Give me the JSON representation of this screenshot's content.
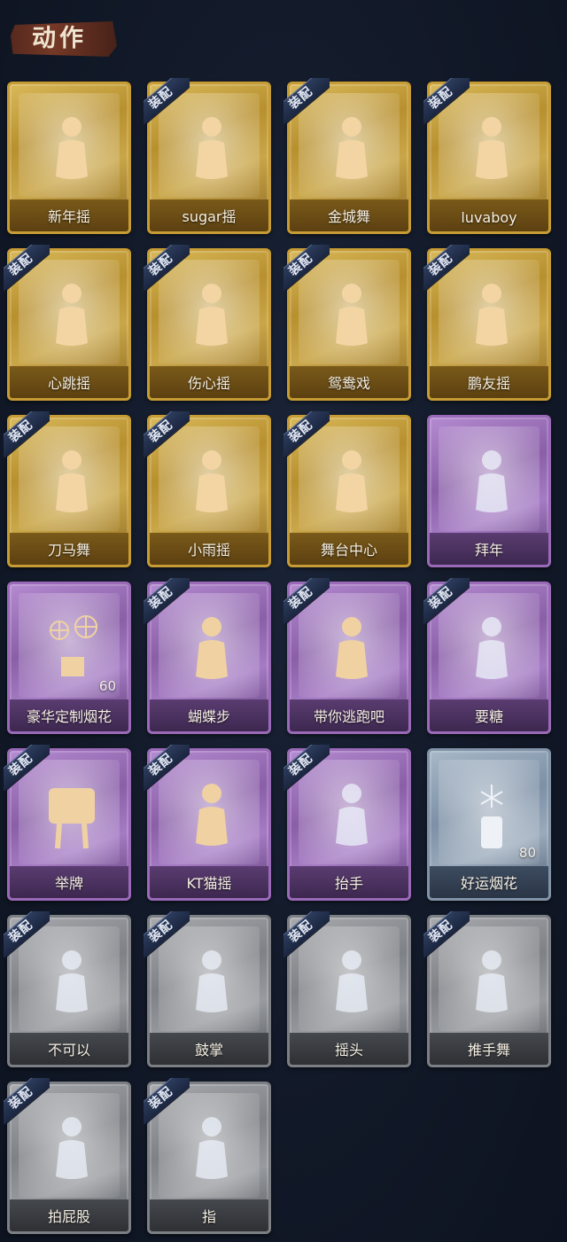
{
  "header": {
    "title": "动作"
  },
  "badge_text": "装配",
  "cards": [
    {
      "label": "新年摇",
      "rarity": "gold",
      "equipped": false,
      "icon": "dancer-clap-icon"
    },
    {
      "label": "sugar摇",
      "rarity": "gold",
      "equipped": true,
      "icon": "dancer-music-icon"
    },
    {
      "label": "金城舞",
      "rarity": "gold",
      "equipped": true,
      "icon": "dancer-wave-icon"
    },
    {
      "label": "luvaboy",
      "rarity": "gold",
      "equipped": true,
      "icon": "dancer-cross-arms-icon"
    },
    {
      "label": "心跳摇",
      "rarity": "gold",
      "equipped": true,
      "icon": "dancer-raise-arm-icon"
    },
    {
      "label": "伤心摇",
      "rarity": "gold",
      "equipped": true,
      "icon": "dancer-heart-hands-icon"
    },
    {
      "label": "鸳鸯戏",
      "rarity": "gold",
      "equipped": true,
      "icon": "dancer-music-icon"
    },
    {
      "label": "鹏友摇",
      "rarity": "gold",
      "equipped": true,
      "icon": "dancer-point-icon"
    },
    {
      "label": "刀马舞",
      "rarity": "gold",
      "equipped": true,
      "icon": "dancer-fist-icon"
    },
    {
      "label": "小雨摇",
      "rarity": "gold",
      "equipped": true,
      "icon": "dancer-music-icon"
    },
    {
      "label": "舞台中心",
      "rarity": "gold",
      "equipped": true,
      "icon": "dancer-sparkle-icon"
    },
    {
      "label": "拜年",
      "rarity": "purple",
      "equipped": false,
      "icon": "bow-greeting-icon"
    },
    {
      "label": "豪华定制烟花",
      "rarity": "purple",
      "equipped": false,
      "icon": "fireworks-box-icon",
      "count": "60"
    },
    {
      "label": "蝴蝶步",
      "rarity": "purple",
      "equipped": true,
      "icon": "dancer-point-icon"
    },
    {
      "label": "带你逃跑吧",
      "rarity": "purple",
      "equipped": true,
      "icon": "dancer-music-icon"
    },
    {
      "label": "要糖",
      "rarity": "purple",
      "equipped": true,
      "icon": "reach-out-icon"
    },
    {
      "label": "举牌",
      "rarity": "purple",
      "equipped": true,
      "icon": "sign-hold-icon"
    },
    {
      "label": "KT猫摇",
      "rarity": "purple",
      "equipped": true,
      "icon": "dancer-music-icon"
    },
    {
      "label": "抬手",
      "rarity": "purple",
      "equipped": true,
      "icon": "raise-hand-icon"
    },
    {
      "label": "好运烟花",
      "rarity": "blue",
      "equipped": false,
      "icon": "firework-can-icon",
      "count": "80"
    },
    {
      "label": "不可以",
      "rarity": "gray",
      "equipped": true,
      "icon": "finger-wag-icon"
    },
    {
      "label": "鼓掌",
      "rarity": "gray",
      "equipped": true,
      "icon": "clap-hands-icon"
    },
    {
      "label": "摇头",
      "rarity": "gray",
      "equipped": true,
      "icon": "shake-head-icon"
    },
    {
      "label": "推手舞",
      "rarity": "gray",
      "equipped": true,
      "icon": "push-hands-icon"
    },
    {
      "label": "拍屁股",
      "rarity": "gray",
      "equipped": true,
      "icon": "slap-icon"
    },
    {
      "label": "指",
      "rarity": "gray",
      "equipped": true,
      "icon": "point-icon"
    }
  ]
}
